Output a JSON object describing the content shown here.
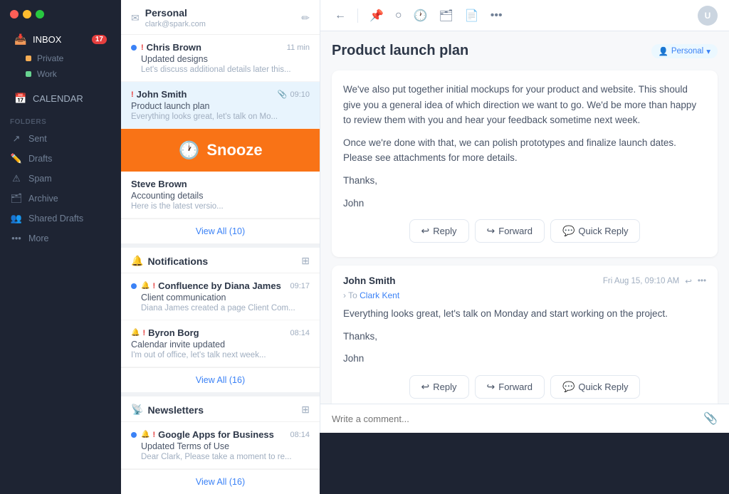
{
  "sidebar": {
    "inbox_label": "INBOX",
    "inbox_badge": "17",
    "private_label": "Private",
    "work_label": "Work",
    "calendar_label": "CALENDAR",
    "folders_label": "Folders",
    "sent_label": "Sent",
    "drafts_label": "Drafts",
    "spam_label": "Spam",
    "archive_label": "Archive",
    "shared_drafts_label": "Shared Drafts",
    "more_label": "More"
  },
  "personal_section": {
    "title": "Personal",
    "email": "clark@spark.com"
  },
  "emails": [
    {
      "sender": "Chris Brown",
      "priority": true,
      "time": "11 min",
      "subject": "Updated designs",
      "preview": "Let's discuss additional details later this...",
      "unread": true
    },
    {
      "sender": "John Smith",
      "priority": true,
      "time": "09:10",
      "subject": "Product launch plan",
      "preview": "Everything looks great, let's talk on Mo...",
      "unread": false,
      "has_attachment": true,
      "selected": true
    }
  ],
  "snooze": {
    "label": "Snooze"
  },
  "steve_email": {
    "sender": "Steve Brown",
    "subject": "Accounting details",
    "preview": "Here is the latest versio..."
  },
  "view_all_personal": "View All (10)",
  "notifications_section": {
    "title": "Notifications"
  },
  "notifications": [
    {
      "sender": "Confluence by Diana James",
      "time": "09:17",
      "subject": "Client communication",
      "preview": "Diana James created a page Client Com...",
      "unread": true
    },
    {
      "sender": "Byron Borg",
      "time": "08:14",
      "subject": "Calendar invite updated",
      "preview": "I'm out of office, let's talk next week...",
      "unread": false
    }
  ],
  "view_all_notifications": "View All (16)",
  "newsletters_section": {
    "title": "Newsletters"
  },
  "newsletters": [
    {
      "sender": "Google Apps for Business",
      "time": "08:14",
      "subject": "Updated Terms of Use",
      "preview": "Dear Clark, Please take a moment to re...",
      "unread": true
    }
  ],
  "view_all_newsletters": "View All (16)",
  "detail": {
    "subject": "Product launch plan",
    "personal_badge": "Personal",
    "message1": {
      "body_p1": "We've also put together initial mockups for your product and website. This should give you a general idea of which direction we want to go. We'd be more than happy to review them with you and hear your feedback sometime next week.",
      "body_p2": "Once we're done with that, we can polish prototypes and finalize launch dates. Please see attachments for more details.",
      "body_p3": "Thanks,",
      "body_p4": "John"
    },
    "message2": {
      "sender": "John Smith",
      "to": "Clark Kent",
      "date": "Fri Aug 15, 09:10 AM",
      "body_p1": "Everything looks great, let's talk on Monday and start working on the project.",
      "body_p2": "Thanks,",
      "body_p3": "John"
    }
  },
  "actions": {
    "reply": "Reply",
    "forward": "Forward",
    "quick_reply": "Quick Reply"
  },
  "compose": {
    "placeholder": "Write a comment..."
  }
}
